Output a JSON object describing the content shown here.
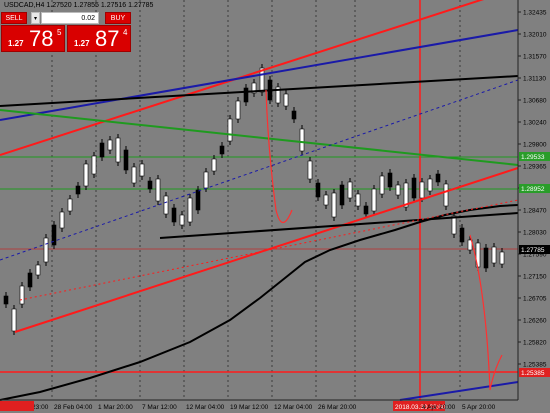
{
  "header": {
    "title": "USDCAD,H4  1.27520 1.27855 1.27516 1.27785"
  },
  "trade_panel": {
    "sell_label": "SELL",
    "buy_label": "BUY",
    "lot": "0.02",
    "spin_glyph": "▾",
    "bid": {
      "prefix": "1.27",
      "big": "78",
      "sup": "5"
    },
    "ask": {
      "prefix": "1.27",
      "big": "87",
      "sup": "4"
    }
  },
  "price_axis": {
    "ticks": [
      "1.32435",
      "1.32010",
      "1.31570",
      "1.31130",
      "1.30680",
      "1.30240",
      "1.29800",
      "1.29365",
      "1.28920",
      "1.28470",
      "1.28030",
      "1.27590",
      "1.27150",
      "1.26705",
      "1.26260",
      "1.25820",
      "1.25385"
    ],
    "highlight_labels": [
      {
        "text": "1.29533",
        "color": "#2a9d2a"
      },
      {
        "text": "1.28952",
        "color": "#2a9d2a"
      },
      {
        "text": "1.27785",
        "color": "#000000"
      },
      {
        "text": "1.25385",
        "color": "#e02020"
      }
    ]
  },
  "time_axis": {
    "labels": [
      "20 Feb 23:00",
      "28 Feb 04:00",
      "1 Mar 20:00",
      "7 Mar 12:00",
      "12 Mar 04:00",
      "19 Mar 12:00",
      "12 Mar 04:00",
      "26 Mar 20:00",
      "2018.03.30 23:00",
      "4 Apr 20:00",
      "5 Apr 20:00"
    ],
    "highlight_index": 8
  },
  "colors": {
    "background": "#808080",
    "bull_candle": "#ffffff",
    "bear_candle": "#000000",
    "trend_red": "#ff1a1a",
    "trend_blue": "#1a1aa8",
    "trend_black": "#000000",
    "trend_green": "#1f9a1f",
    "grid": "#505050"
  }
}
